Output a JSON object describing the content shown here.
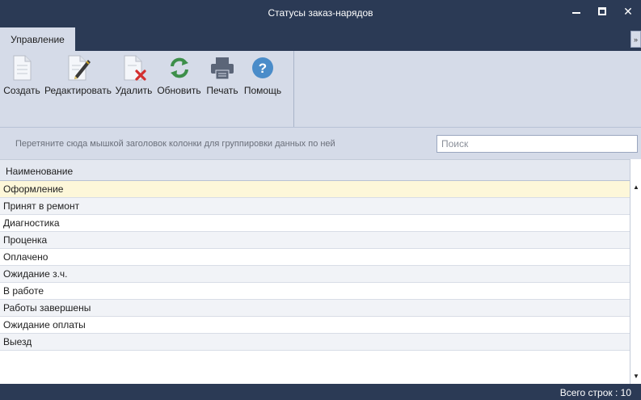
{
  "window": {
    "title": "Статусы заказ-нарядов",
    "minimize_glyph": "—",
    "maximize_glyph": "☐",
    "close_glyph": "✕"
  },
  "ribbon": {
    "tabs": [
      {
        "label": "Управление",
        "active": true
      }
    ],
    "buttons": {
      "create": {
        "label": "Создать",
        "icon": "new-document-icon"
      },
      "edit": {
        "label": "Редактировать",
        "icon": "edit-document-icon"
      },
      "delete": {
        "label": "Удалить",
        "icon": "delete-document-icon"
      },
      "refresh": {
        "label": "Обновить",
        "icon": "refresh-icon"
      },
      "print": {
        "label": "Печать",
        "icon": "printer-icon"
      },
      "help": {
        "label": "Помощь",
        "icon": "help-icon"
      }
    }
  },
  "grouping": {
    "hint": "Перетяните сюда мышкой заголовок колонки для группировки данных по ней"
  },
  "search": {
    "placeholder": "Поиск",
    "value": ""
  },
  "grid": {
    "columns": [
      "Наименование"
    ],
    "rows": [
      "Оформление",
      "Принят в ремонт",
      "Диагностика",
      "Проценка",
      "Оплачено",
      "Ожидание з.ч.",
      "В работе",
      "Работы завершены",
      "Ожидание оплаты",
      "Выезд"
    ],
    "selected_index": 0
  },
  "status": {
    "total_rows": "Всего строк : 10"
  },
  "colors": {
    "chrome": "#2b3a55",
    "ribbon": "#d5dbe8",
    "selection": "#fdf7d9",
    "refresh_green": "#3d8f4a",
    "help_blue": "#4a8cc9",
    "delete_red": "#d32f2f"
  }
}
